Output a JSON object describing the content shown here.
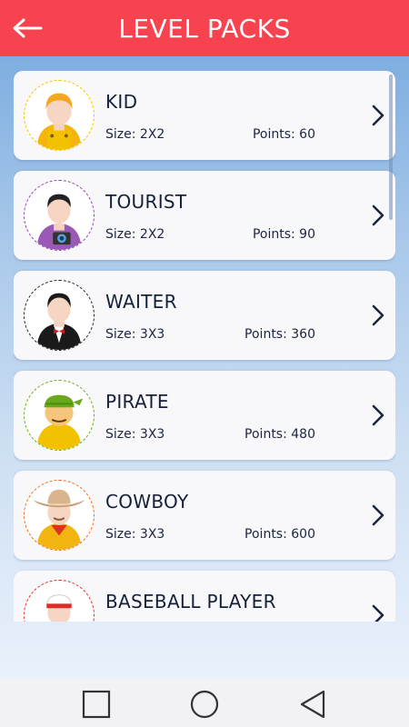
{
  "header": {
    "title": "LEVEL PACKS",
    "back_icon": "arrow-left-icon"
  },
  "theme": {
    "header_color": "#f7424f",
    "card_background": "#f8f8fa",
    "text_color": "#15203a"
  },
  "packs": [
    {
      "name": "KID",
      "size": "Size: 2X2",
      "points": "Points: 60",
      "icon": "kid-avatar-icon",
      "ring_color": "#f2c200"
    },
    {
      "name": "TOURIST",
      "size": "Size: 2X2",
      "points": "Points: 90",
      "icon": "tourist-avatar-icon",
      "ring_color": "#8e44ad"
    },
    {
      "name": "WAITER",
      "size": "Size: 3X3",
      "points": "Points: 360",
      "icon": "waiter-avatar-icon",
      "ring_color": "#222222"
    },
    {
      "name": "PIRATE",
      "size": "Size: 3X3",
      "points": "Points: 480",
      "icon": "pirate-avatar-icon",
      "ring_color": "#6aa81e"
    },
    {
      "name": "COWBOY",
      "size": "Size: 3X3",
      "points": "Points: 600",
      "icon": "cowboy-avatar-icon",
      "ring_color": "#f06a1a"
    },
    {
      "name": "BASEBALL PLAYER",
      "icon": "baseball-player-avatar-icon",
      "ring_color": "#e02a2a"
    }
  ],
  "navbar": {
    "items": [
      "recent-apps-icon",
      "home-icon",
      "back-icon"
    ]
  }
}
